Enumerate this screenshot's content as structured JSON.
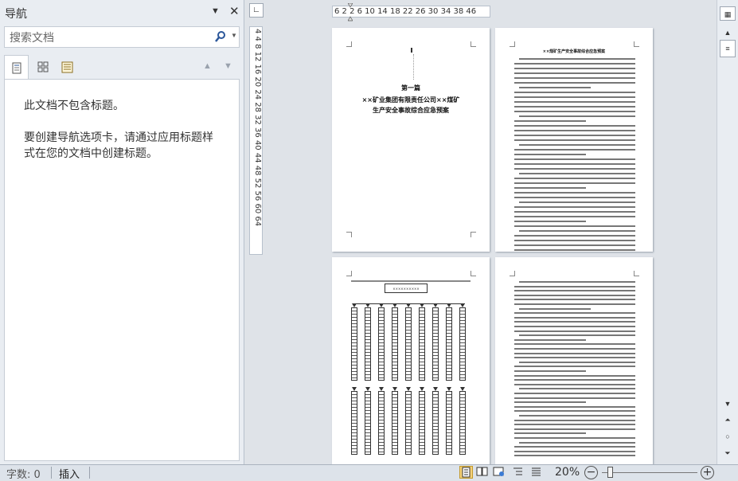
{
  "nav": {
    "title": "导航",
    "search_placeholder": "搜索文档",
    "no_headings": "此文档不包含标题。",
    "help": "要创建导航选项卡，请通过应用标题样式在您的文档中创建标题。",
    "tabs": [
      "headings-tab",
      "pages-tab",
      "results-tab"
    ]
  },
  "rulers": {
    "horizontal": "6  2  2  6 10 14 18 22 26 30 34 38     46",
    "vertical": "4   4  8 12 16 20 24 28 32 36 40 44 48 52 56 60 64"
  },
  "pages": {
    "p1_title": [
      "第一篇",
      "××矿业集团有限责任公司××煤矿",
      "生产安全事故综合应急预案"
    ],
    "p2_heading": "××煤矿生产安全事故综合应急预案",
    "p3_box": "××××××××××"
  },
  "status": {
    "word_count": "字数: 0",
    "insert_mode": "插入",
    "zoom": "20%"
  },
  "colors": {
    "accent": "#2b579a",
    "pane_bg": "#e9edf2",
    "doc_bg": "#dfe3e8"
  }
}
